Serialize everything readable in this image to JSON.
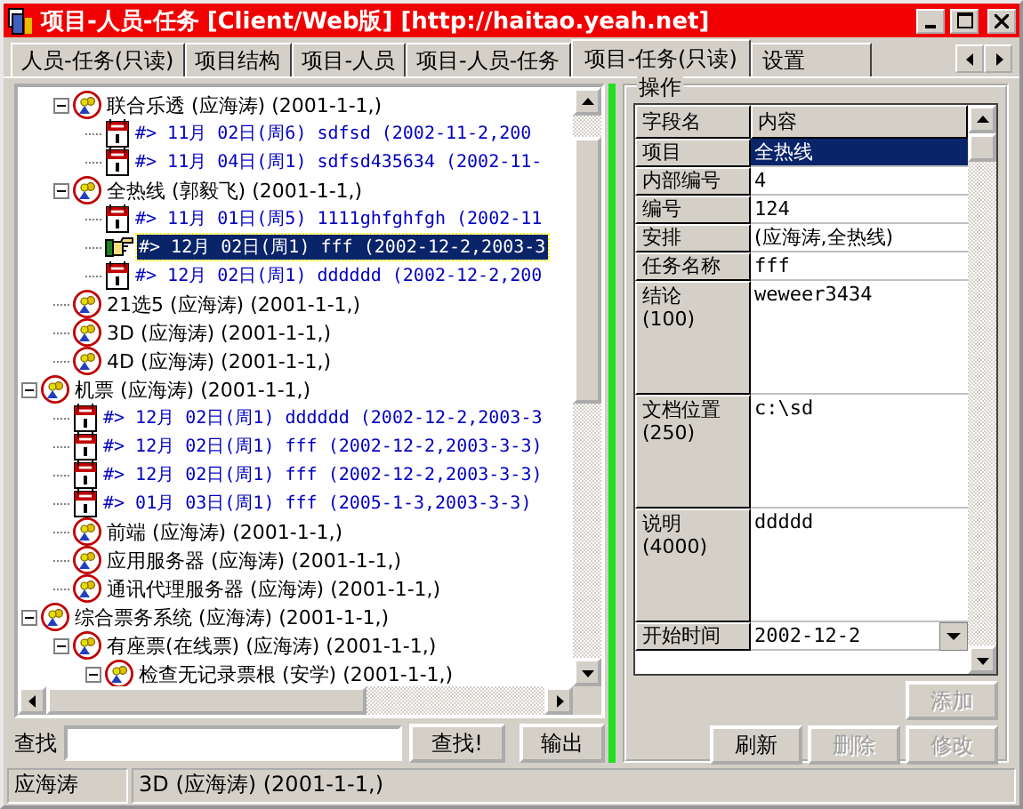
{
  "window": {
    "title": "项目-人员-任务 [Client/Web版] [http://haitao.yeah.net]"
  },
  "tabs": [
    {
      "label": "人员-任务(只读)",
      "selected": false
    },
    {
      "label": "项目结构",
      "selected": false
    },
    {
      "label": "项目-人员",
      "selected": false
    },
    {
      "label": "项目-人员-任务",
      "selected": false
    },
    {
      "label": "项目-任务(只读)",
      "selected": true
    },
    {
      "label": "设置",
      "selected": false
    }
  ],
  "tree": {
    "nodes": [
      {
        "children": [
          {
            "label": "联合乐透 (应海涛) (2001-1-1,)",
            "kind": "project",
            "expanded": true,
            "children": [
              {
                "label": "#> 11月 02日(周6) sdfsd (2002-11-2,200",
                "kind": "task",
                "selected": false
              },
              {
                "label": "#> 11月 04日(周1) sdfsd435634 (2002-11-",
                "kind": "task",
                "selected": false
              }
            ]
          },
          {
            "label": "全热线 (郭毅飞) (2001-1-1,)",
            "kind": "project",
            "expanded": true,
            "children": [
              {
                "label": "#> 11月 01日(周5) 1111ghfghfgh (2002-11",
                "kind": "task",
                "selected": false
              },
              {
                "label": "#> 12月 02日(周1) fff (2002-12-2,2003-3",
                "kind": "task",
                "selected": true
              },
              {
                "label": "#> 12月 02日(周1) dddddd (2002-12-2,200",
                "kind": "task",
                "selected": false
              }
            ]
          },
          {
            "label": "21选5 (应海涛) (2001-1-1,)",
            "kind": "project"
          },
          {
            "label": "3D (应海涛) (2001-1-1,)",
            "kind": "project"
          },
          {
            "label": "4D (应海涛) (2001-1-1,)",
            "kind": "project"
          }
        ]
      },
      {
        "label": "机票 (应海涛) (2001-1-1,)",
        "kind": "project",
        "expanded": true,
        "children": [
          {
            "label": "#> 12月 02日(周1) dddddd (2002-12-2,2003-3",
            "kind": "task",
            "selected": false
          },
          {
            "label": "#> 12月 02日(周1) fff (2002-12-2,2003-3-3)",
            "kind": "task",
            "selected": false
          },
          {
            "label": "#> 12月 02日(周1) fff (2002-12-2,2003-3-3)",
            "kind": "task",
            "selected": false
          },
          {
            "label": "#> 01月 03日(周1) fff (2005-1-3,2003-3-3)",
            "kind": "task",
            "selected": false
          },
          {
            "label": "前端 (应海涛) (2001-1-1,)",
            "kind": "project"
          },
          {
            "label": "应用服务器 (应海涛) (2001-1-1,)",
            "kind": "project"
          },
          {
            "label": "通讯代理服务器 (应海涛) (2001-1-1,)",
            "kind": "project"
          }
        ]
      },
      {
        "label": "综合票务系统 (应海涛) (2001-1-1,)",
        "kind": "project",
        "expanded": true,
        "children": [
          {
            "label": "有座票(在线票) (应海涛) (2001-1-1,)",
            "kind": "project",
            "expanded": true,
            "children": [
              {
                "label": "检查无记录票根 (安学) (2001-1-1,)",
                "kind": "project",
                "expanded": true
              }
            ]
          }
        ]
      }
    ]
  },
  "find": {
    "label": "查找",
    "button": "查找!",
    "export": "输出"
  },
  "panel": {
    "title": "操作",
    "columns": [
      "字段名",
      "内容"
    ],
    "rows": [
      {
        "field": "项目",
        "value": "全热线",
        "kind": "line",
        "selected": true
      },
      {
        "field": "内部编号",
        "value": "4",
        "kind": "line",
        "selected": false
      },
      {
        "field": "编号",
        "value": "124",
        "kind": "line",
        "selected": false
      },
      {
        "field": "安排",
        "value": "(应海涛,全热线)",
        "kind": "line",
        "selected": false
      },
      {
        "field": "任务名称",
        "value": "fff",
        "kind": "line",
        "selected": false
      },
      {
        "field": "结论",
        "limit": "(100)",
        "value": "weweer3434",
        "kind": "memo",
        "selected": false
      },
      {
        "field": "文档位置",
        "limit": "(250)",
        "value": "c:\\sd",
        "kind": "memo",
        "selected": false
      },
      {
        "field": "说明",
        "limit": "(4000)",
        "value": "ddddd",
        "kind": "memo",
        "selected": false
      },
      {
        "field": "开始时间",
        "value": "2002-12-2",
        "kind": "date",
        "selected": false
      }
    ],
    "button_rows": [
      [
        {
          "label": "添加",
          "disabled": true
        }
      ],
      [
        {
          "label": "刷新",
          "disabled": false
        },
        {
          "label": "删除",
          "disabled": true
        },
        {
          "label": "修改",
          "disabled": true
        }
      ]
    ]
  },
  "status_bar": [
    "应海涛",
    "3D (应海涛) (2001-1-1,)"
  ]
}
